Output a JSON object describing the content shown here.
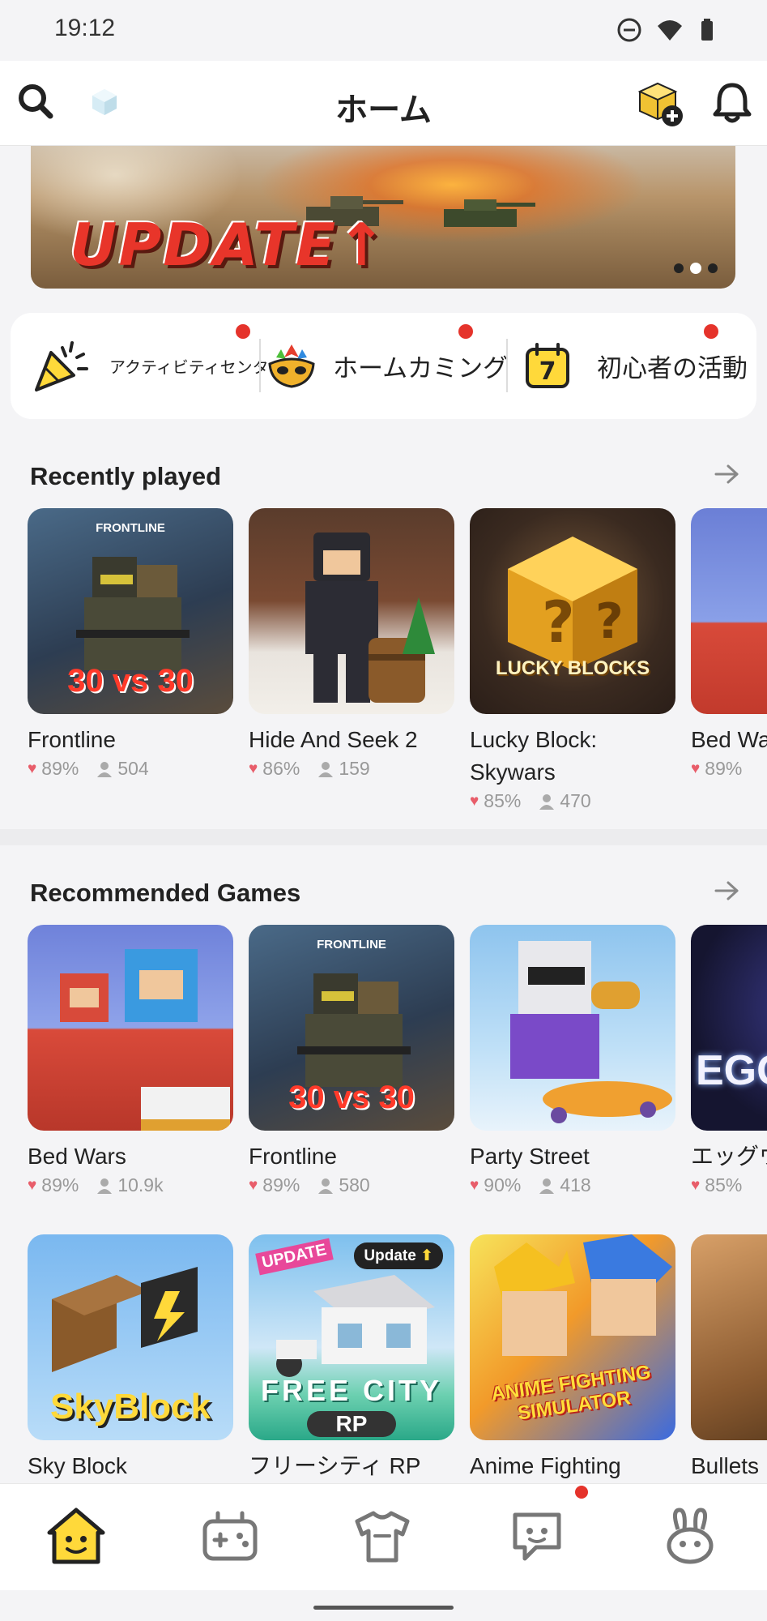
{
  "status_bar": {
    "time": "19:12"
  },
  "header": {
    "title": "ホーム"
  },
  "banner": {
    "title": "UPDATE↑",
    "dots": 3,
    "active_dot": 1
  },
  "events": [
    {
      "label": "アクティビティセンタ",
      "icon": "party-popper-icon",
      "has_dot": true
    },
    {
      "label": "ホームカミング",
      "icon": "carnival-mask-icon",
      "has_dot": true
    },
    {
      "label": "初心者の活動",
      "icon": "calendar-7-icon",
      "has_dot": true
    }
  ],
  "recently_played": {
    "title": "Recently played",
    "games": [
      {
        "name": "Frontline",
        "rating": "89%",
        "players": "504",
        "thumb_top": "FRONTLINE",
        "thumb_bottom": "30 vs 30"
      },
      {
        "name": "Hide And Seek 2",
        "rating": "86%",
        "players": "159"
      },
      {
        "name": "Lucky Block: Skywars",
        "rating": "85%",
        "players": "470",
        "thumb_bottom": "LUCKY BLOCKS"
      },
      {
        "name": "Bed Wa",
        "rating": "89%",
        "players": ""
      }
    ]
  },
  "recommended": {
    "title": "Recommended Games",
    "row1": [
      {
        "name": "Bed Wars",
        "rating": "89%",
        "players": "10.9k"
      },
      {
        "name": "Frontline",
        "rating": "89%",
        "players": "580",
        "thumb_top": "FRONTLINE",
        "thumb_bottom": "30 vs 30"
      },
      {
        "name": "Party Street",
        "rating": "90%",
        "players": "418"
      },
      {
        "name": "エッグウ",
        "rating": "85%",
        "players": "",
        "thumb_bottom": "EGG"
      }
    ],
    "row2": [
      {
        "name": "Sky Block",
        "thumb_bottom": "SkyBlock"
      },
      {
        "name": "フリーシティ RP",
        "thumb_badge": "Update",
        "thumb_tag": "UPDATE",
        "thumb_bottom": "FREE CITY",
        "thumb_sub": "RP"
      },
      {
        "name": "Anime Fighting",
        "thumb_bottom": "ANIME FIGHTING SIMULATOR"
      },
      {
        "name": "Bullets"
      }
    ]
  },
  "bottom_nav": [
    {
      "icon": "home-smiley-icon",
      "active": true
    },
    {
      "icon": "gamepad-icon",
      "active": false
    },
    {
      "icon": "tshirt-icon",
      "active": false
    },
    {
      "icon": "chat-bubble-icon",
      "active": false,
      "has_dot": true
    },
    {
      "icon": "bunny-icon",
      "active": false
    }
  ],
  "colors": {
    "accent_yellow": "#ffd93a",
    "notification_red": "#e5332b",
    "heart": "#e85d6a",
    "background": "#f4f4f6"
  }
}
